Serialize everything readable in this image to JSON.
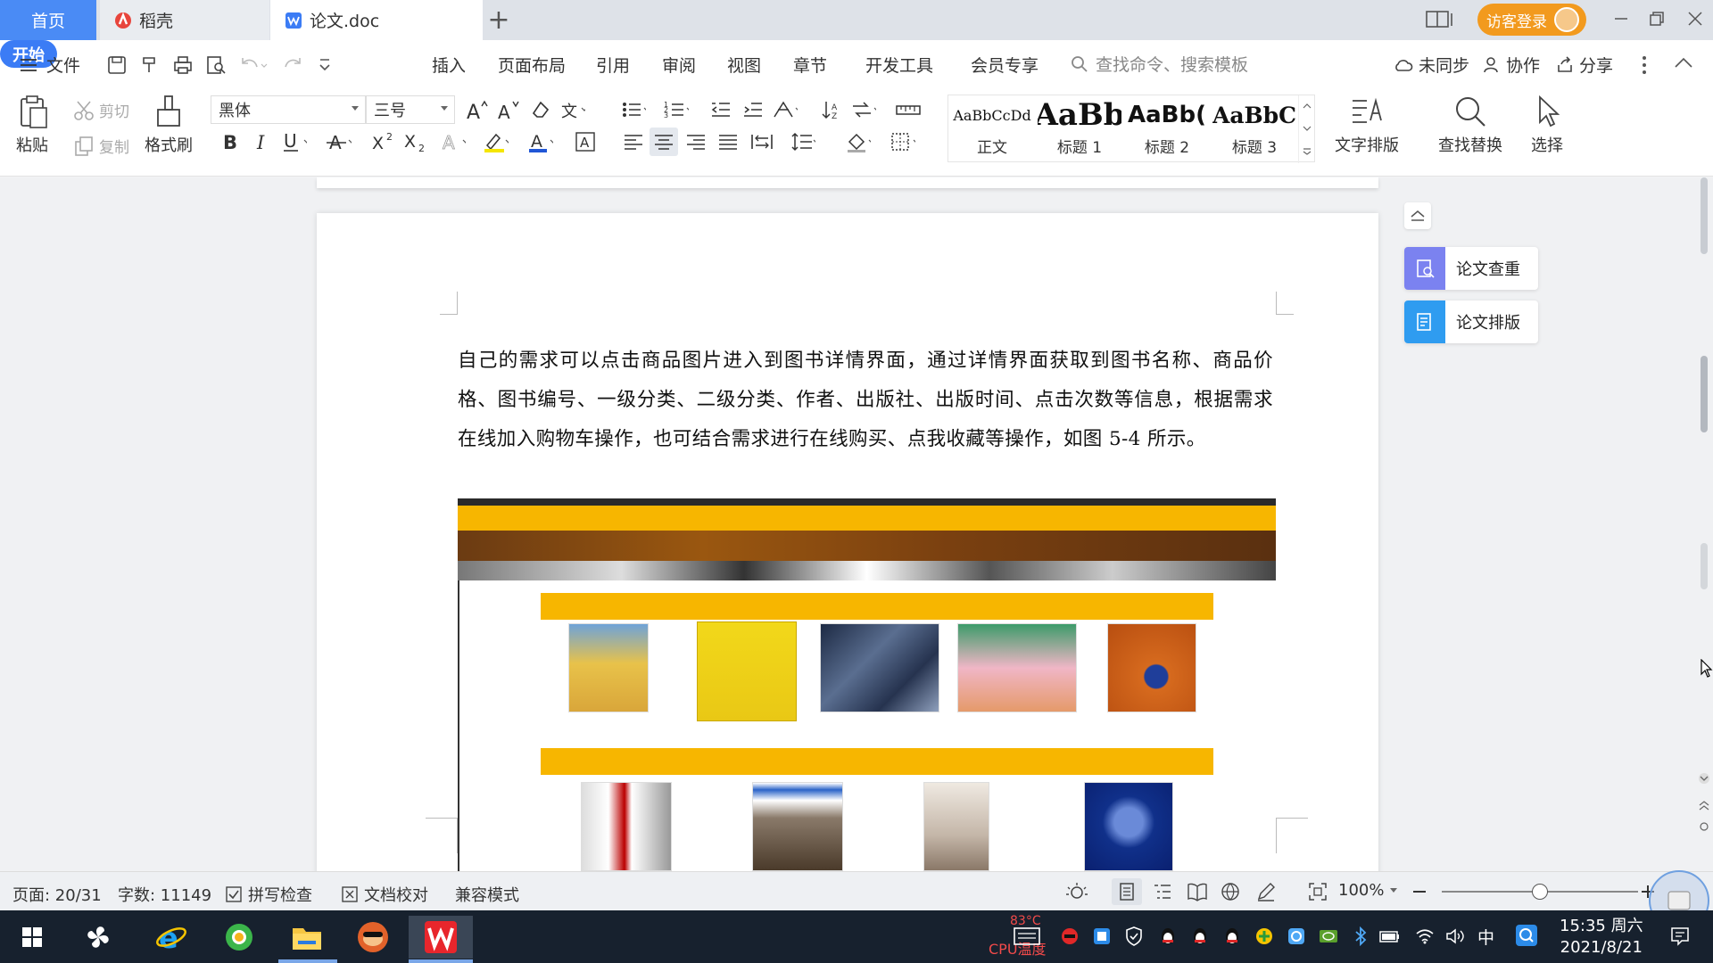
{
  "tabs": {
    "home": "首页",
    "daoke": "稻壳",
    "document": "论文.doc",
    "new_tab": "+"
  },
  "account": {
    "login_label": "访客登录"
  },
  "menu": {
    "file": "文件",
    "items": [
      "开始",
      "插入",
      "页面布局",
      "引用",
      "审阅",
      "视图",
      "章节",
      "开发工具",
      "会员专享"
    ],
    "search_placeholder": "查找命令、搜索模板",
    "sync": "未同步",
    "collab": "协作",
    "share": "分享"
  },
  "ribbon": {
    "paste": "粘贴",
    "cut": "剪切",
    "copy": "复制",
    "format_painter": "格式刷",
    "font_name": "黑体",
    "font_size": "三号",
    "styles": [
      {
        "preview": "AaBbCcDd",
        "name": "正文"
      },
      {
        "preview": "AaBb",
        "name": "标题 1"
      },
      {
        "preview": "AaBb(",
        "name": "标题 2"
      },
      {
        "preview": "AaBbC",
        "name": "标题 3"
      }
    ],
    "text_layout": "文字排版",
    "find_replace": "查找替换",
    "select": "选择"
  },
  "document": {
    "paragraph": "自己的需求可以点击商品图片进入到图书详情界面，通过详情界面获取到图书名称、商品价格、图书编号、一级分类、二级分类、作者、出版社、出版时间、点击次数等信息，根据需求在线加入购物车操作，也可结合需求进行在线购买、点我收藏等操作，如图 5-4 所示。"
  },
  "side_panel": {
    "check": "论文查重",
    "layout": "论文排版"
  },
  "status": {
    "page": "页面: 20/31",
    "words": "字数: 11149",
    "spell_check": "拼写检查",
    "doc_check": "文档校对",
    "compat_mode": "兼容模式",
    "zoom": "100%",
    "zoom_level": 0.5
  },
  "taskbar": {
    "cpu_temp": "83°C",
    "cpu_label": "CPU温度",
    "ime": "中",
    "time": "15:35 周六",
    "date": "2021/8/21"
  },
  "colors": {
    "accent_blue": "#3b7cf5",
    "visitor_orange": "#f29a1e",
    "banner_yellow": "#f7b600",
    "taskbar": "#17212e"
  }
}
